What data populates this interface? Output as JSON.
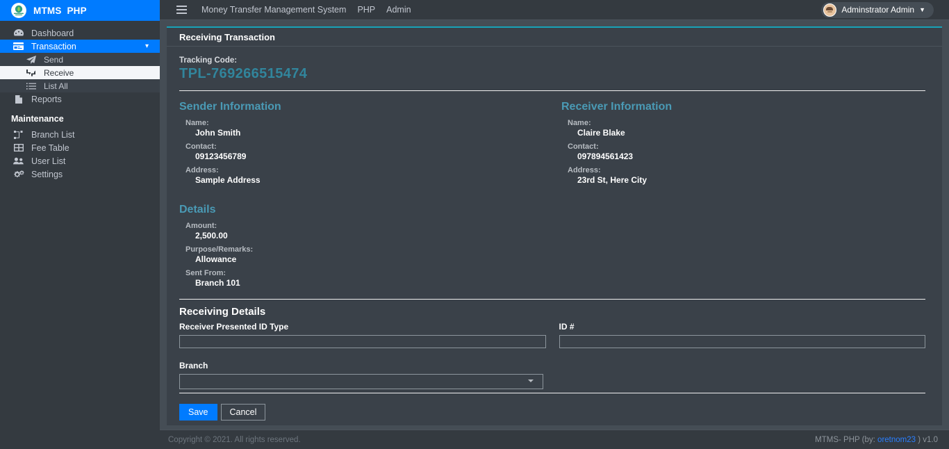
{
  "brand": {
    "logo_icon": "money-transfer-logo",
    "title": "MTMS  PHP"
  },
  "sidebar": {
    "items": [
      {
        "label": "Dashboard",
        "icon": "tachometer-icon",
        "state": "normal",
        "level": "top"
      },
      {
        "label": "Transaction",
        "icon": "credit-card-icon",
        "state": "active",
        "level": "top",
        "caret": "chevron-down-icon"
      },
      {
        "label": "Send",
        "icon": "paper-plane-icon",
        "state": "normal",
        "level": "sub"
      },
      {
        "label": "Receive",
        "icon": "exchange-arrows-icon",
        "state": "selected",
        "level": "sub"
      },
      {
        "label": "List All",
        "icon": "list-ol-icon",
        "state": "normal",
        "level": "sub"
      },
      {
        "label": "Reports",
        "icon": "file-icon",
        "state": "normal",
        "level": "top"
      }
    ],
    "section_header": "Maintenance",
    "maintenance_items": [
      {
        "label": "Branch List",
        "icon": "sitemap-icon"
      },
      {
        "label": "Fee Table",
        "icon": "table-icon"
      },
      {
        "label": "User List",
        "icon": "users-icon"
      },
      {
        "label": "Settings",
        "icon": "cogs-icon"
      }
    ]
  },
  "navbar": {
    "menu_icon": "hamburger-icon",
    "links": [
      "Money Transfer Management System",
      "PHP",
      "Admin"
    ],
    "user": {
      "avatar_icon": "user-avatar",
      "name": "Adminstrator Admin",
      "caret": "caret-down-icon"
    }
  },
  "card": {
    "title": "Receiving Transaction",
    "tracking": {
      "label": "Tracking Code:",
      "value": "TPL-769266515474"
    },
    "sender": {
      "title": "Sender Information",
      "fields": [
        {
          "label": "Name:",
          "value": "John Smith"
        },
        {
          "label": "Contact:",
          "value": "09123456789"
        },
        {
          "label": "Address:",
          "value": "Sample Address"
        }
      ]
    },
    "receiver": {
      "title": "Receiver Information",
      "fields": [
        {
          "label": "Name:",
          "value": "Claire Blake"
        },
        {
          "label": "Contact:",
          "value": "097894561423"
        },
        {
          "label": "Address:",
          "value": "23rd St, Here City"
        }
      ]
    },
    "details": {
      "title": "Details",
      "fields": [
        {
          "label": "Amount:",
          "value": "2,500.00"
        },
        {
          "label": "Purpose/Remarks:",
          "value": "Allowance"
        },
        {
          "label": "Sent From:",
          "value": "Branch 101"
        }
      ]
    }
  },
  "form": {
    "title": "Receiving Details",
    "id_type": {
      "label": "Receiver Presented ID Type",
      "value": "",
      "placeholder": ""
    },
    "id_number": {
      "label": "ID #",
      "value": "",
      "placeholder": ""
    },
    "branch": {
      "label": "Branch",
      "value": "",
      "options": [
        ""
      ]
    },
    "save_label": "Save",
    "cancel_label": "Cancel"
  },
  "footer": {
    "copyright": "Copyright © 2021. All rights reserved.",
    "right_prefix": "MTMS- PHP (by: ",
    "right_link": "oretnom23",
    "right_suffix": " ) v1.0"
  },
  "colors": {
    "accent_blue": "#007bff",
    "teal": "#17a2b8",
    "heading_teal": "#4a9ab5",
    "tracking_teal": "#31859c",
    "sidebar_bg": "#343a40",
    "content_bg": "#454d55",
    "card_bg": "#3a4149",
    "link_blue": "#2a7fff"
  }
}
